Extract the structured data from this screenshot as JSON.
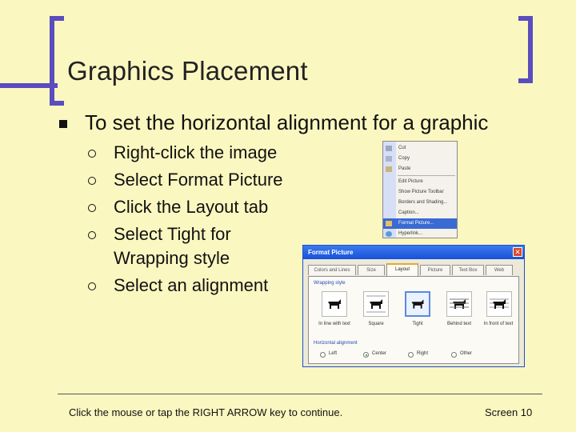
{
  "slide": {
    "title": "Graphics Placement",
    "main_bullet": "To set the horizontal alignment for a graphic",
    "steps": [
      "Right-click the image",
      "Select Format Picture",
      "Click the Layout tab",
      "Select Tight for Wrapping style",
      "Select an alignment"
    ]
  },
  "context_menu": {
    "items": [
      "Cut",
      "Copy",
      "Paste",
      "Edit Picture",
      "Show Picture Toolbar",
      "Borders and Shading...",
      "Caption...",
      "Format Picture...",
      "Hyperlink..."
    ],
    "highlighted": "Format Picture..."
  },
  "dialog": {
    "title": "Format Picture",
    "close_glyph": "✕",
    "tabs": [
      "Colors and Lines",
      "Size",
      "Layout",
      "Picture",
      "Text Box",
      "Web"
    ],
    "active_tab": "Layout",
    "wrapping_label": "Wrapping style",
    "wrapping_options": [
      "In line with text",
      "Square",
      "Tight",
      "Behind text",
      "In front of text"
    ],
    "selected_wrapping": "Tight",
    "alignment_label": "Horizontal alignment",
    "alignment_options": [
      "Left",
      "Center",
      "Right",
      "Other"
    ],
    "selected_alignment": "Center"
  },
  "footer": {
    "instruction": "Click the mouse or tap the RIGHT ARROW key to continue.",
    "screen": "Screen 10"
  },
  "colors": {
    "background": "#fbf7c0",
    "accent": "#5a4dbf",
    "highlight": "#3a6ad4"
  }
}
